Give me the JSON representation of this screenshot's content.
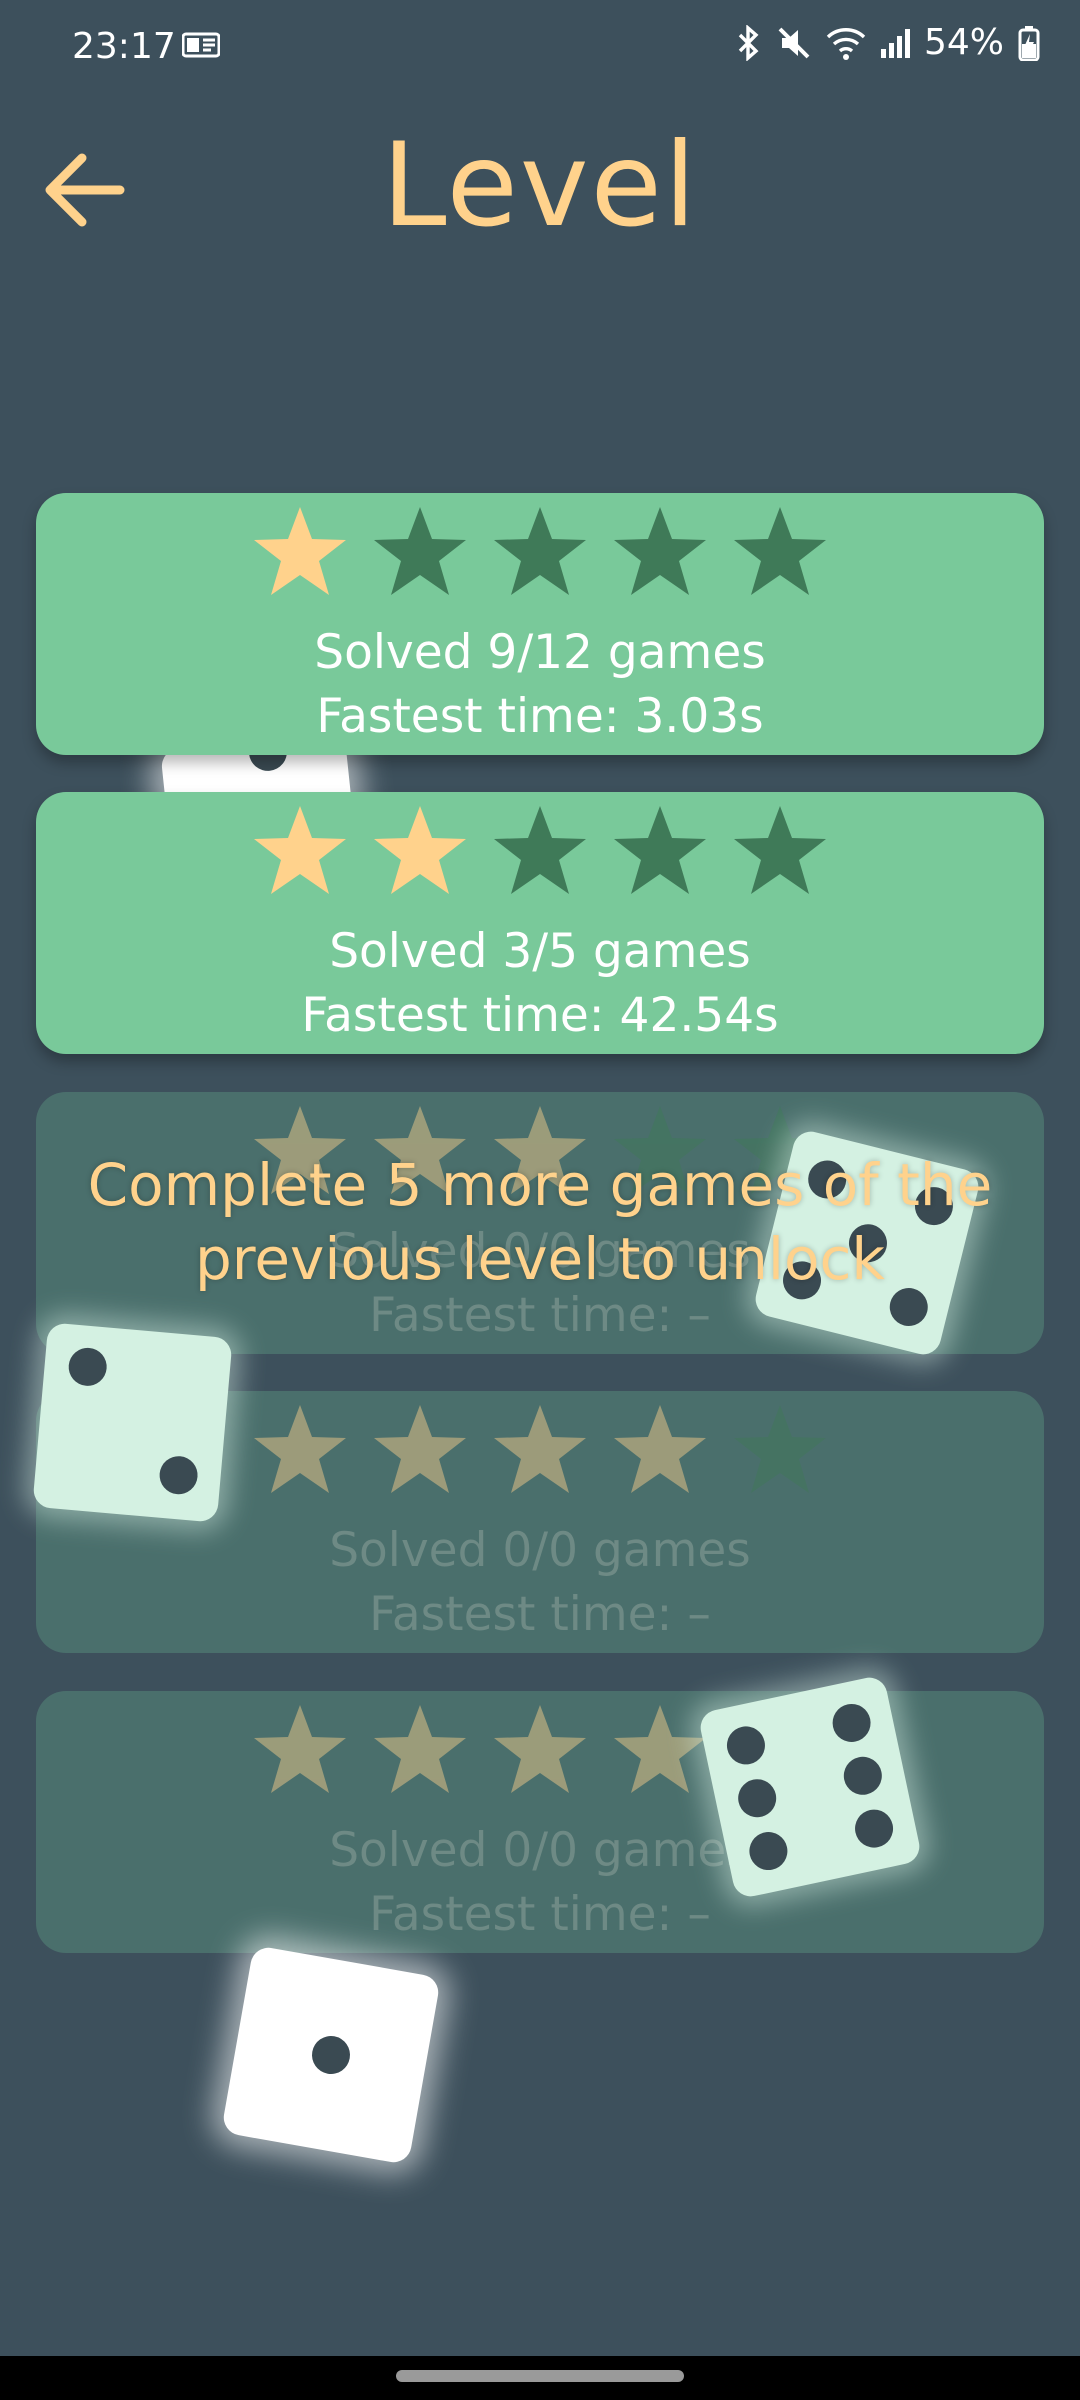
{
  "status": {
    "time": "23:17",
    "battery": "54%",
    "icons": [
      "notification-icon",
      "bluetooth-icon",
      "mute-icon",
      "wifi-icon",
      "signal-icon",
      "battery-icon"
    ]
  },
  "header": {
    "title": "Level",
    "back_icon": "arrow-left-icon"
  },
  "colors": {
    "background": "#3d505c",
    "accent": "#ffd28c",
    "card": "#79c99a",
    "card_locked": "#4a6f6c",
    "star_filled": "#ffd28c",
    "star_empty": "#3f7a58"
  },
  "levels": [
    {
      "stars_earned": 1,
      "stars_total": 5,
      "solved_text": "Solved 9/12 games",
      "fastest_text": "Fastest time: 3.03s",
      "locked": false
    },
    {
      "stars_earned": 2,
      "stars_total": 5,
      "solved_text": "Solved 3/5 games",
      "fastest_text": "Fastest time: 42.54s",
      "locked": false
    },
    {
      "stars_earned": 3,
      "stars_total": 5,
      "solved_text": "Solved 0/0 games",
      "fastest_text": "Fastest time: –",
      "locked": true
    },
    {
      "stars_earned": 4,
      "stars_total": 5,
      "solved_text": "Solved 0/0 games",
      "fastest_text": "Fastest time: –",
      "locked": true
    },
    {
      "stars_earned": 5,
      "stars_total": 5,
      "solved_text": "Solved 0/0 games",
      "fastest_text": "Fastest time: –",
      "locked": true
    }
  ],
  "unlock_message": "Complete 5 more games of the previous level to unlock",
  "dice": [
    {
      "name": "die-one",
      "value": 1
    },
    {
      "name": "die-two",
      "value": 2
    },
    {
      "name": "die-five",
      "value": 5
    },
    {
      "name": "die-six",
      "value": 6
    },
    {
      "name": "die-partial",
      "value": 2
    }
  ]
}
